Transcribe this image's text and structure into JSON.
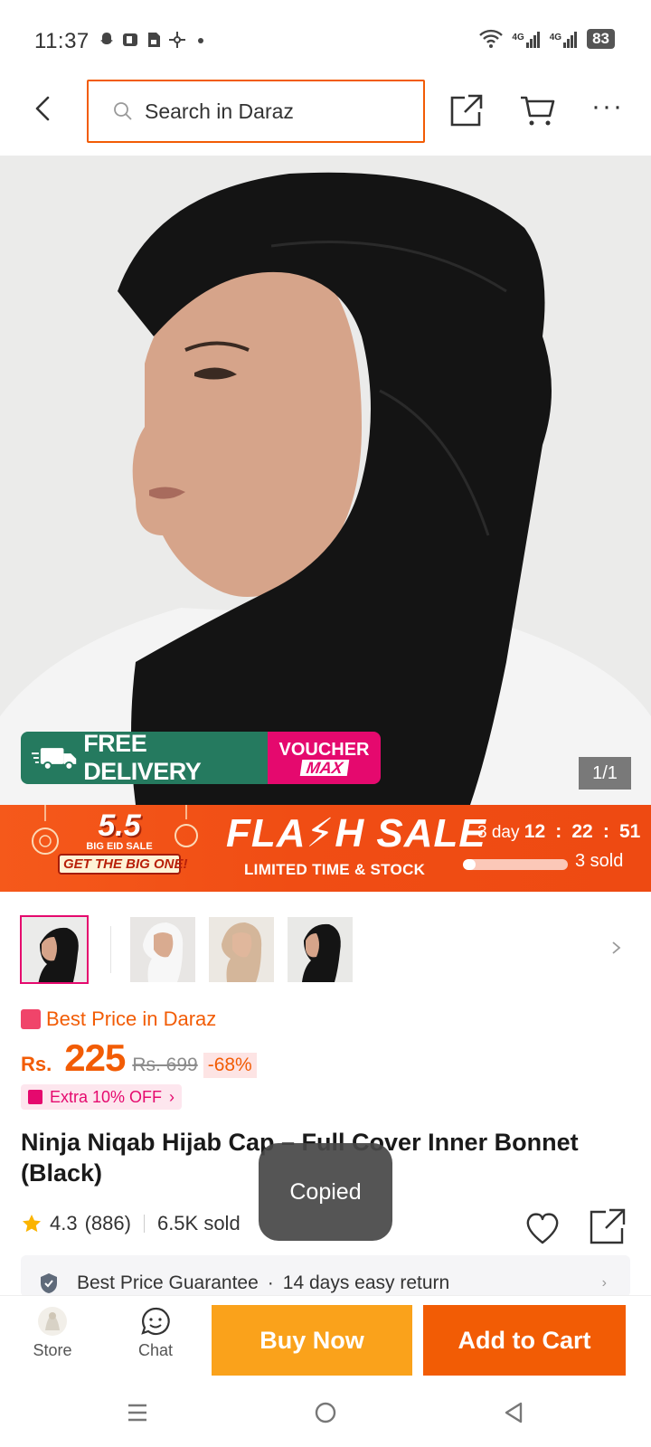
{
  "status_bar": {
    "time": "11:37",
    "battery": "83",
    "network_1": "4G",
    "network_2": "4G"
  },
  "header": {
    "search_placeholder": "Search in Daraz",
    "accent_color": "#f25c05"
  },
  "gallery": {
    "counter": "1/1",
    "promo_free": "FREE DELIVERY",
    "promo_voucher_top": "VOUCHER",
    "promo_voucher_bottom": "MAX"
  },
  "flash_sale": {
    "eid_number": "5.5",
    "eid_label": "BIG EID SALE",
    "eid_cta": "GET THE BIG ONE!",
    "title": "FLA⚡H SALE",
    "subtitle": "LIMITED TIME & STOCK",
    "timer_days": "3 day",
    "timer_h": "12",
    "timer_m": "22",
    "timer_s": "51",
    "sold": "3 sold",
    "sold_fraction": 0.12
  },
  "thumbnails": [
    {
      "name": "black-cap",
      "active": true
    },
    {
      "name": "white-cap",
      "active": false
    },
    {
      "name": "beige-cap",
      "active": false
    },
    {
      "name": "black-cap-side",
      "active": false
    }
  ],
  "price": {
    "best_price_label": "Best Price in Daraz",
    "currency": "Rs.",
    "current": "225",
    "original": "Rs. 699",
    "discount": "-68%",
    "extra_off": "Extra 10% OFF"
  },
  "product": {
    "title": "Ninja Niqab Hijab Cap – Full Cover Inner Bonnet (Black)",
    "rating": "4.3",
    "reviews": "(886)",
    "sold": "6.5K sold"
  },
  "guarantee": {
    "text_1": "Best Price Guarantee",
    "separator": "·",
    "text_2": "14 days easy return"
  },
  "toast": {
    "text": "Copied"
  },
  "action_bar": {
    "store_label": "Store",
    "chat_label": "Chat",
    "buy_now_label": "Buy Now",
    "add_to_cart_label": "Add to Cart"
  }
}
